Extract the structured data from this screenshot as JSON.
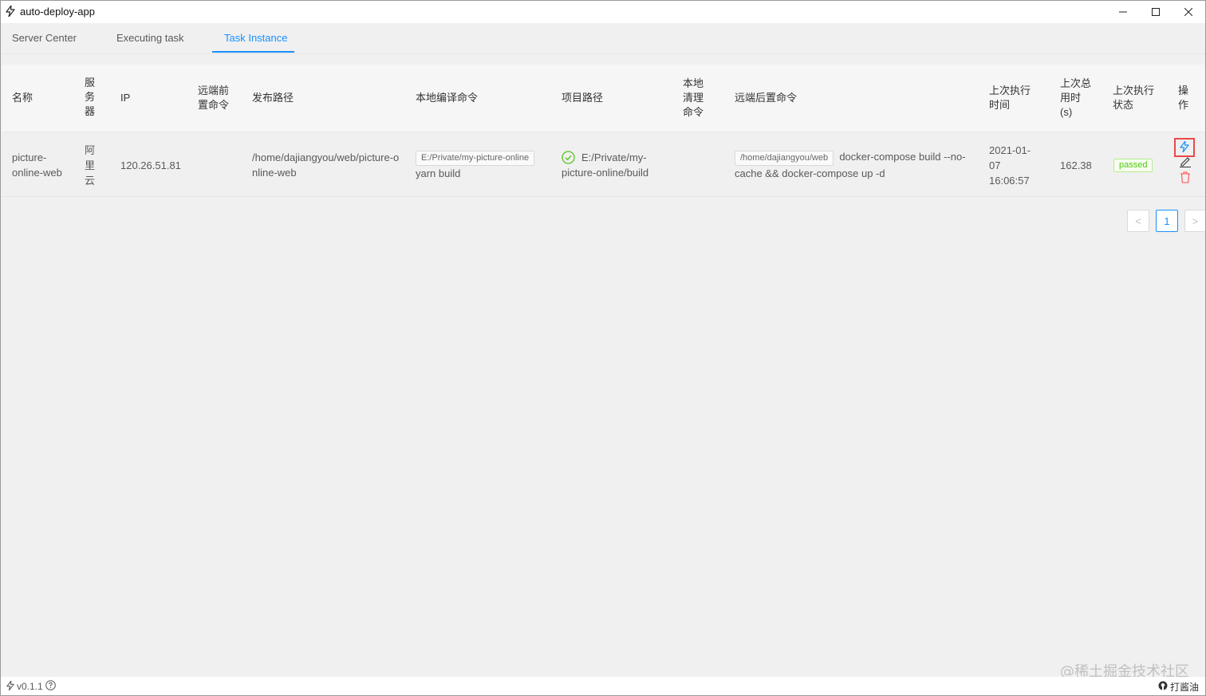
{
  "window": {
    "title": "auto-deploy-app",
    "controls": [
      "minimize-icon",
      "maximize-icon",
      "close-icon"
    ]
  },
  "tabs": [
    {
      "label": "Server Center",
      "active": false
    },
    {
      "label": "Executing task",
      "active": false
    },
    {
      "label": "Task Instance",
      "active": true
    }
  ],
  "table": {
    "headers": {
      "name": "名称",
      "server": "服务器",
      "ip": "IP",
      "remote_pre_cmd": "远端前置命令",
      "deploy_path": "发布路径",
      "local_build_cmd": "本地编译命令",
      "project_path": "项目路径",
      "local_cleanup": "本地清理命令",
      "remote_post_cmd": "远端后置命令",
      "last_exec_time": "上次执行时间",
      "last_duration": "上次总用时(s)",
      "last_status": "上次执行状态",
      "actions": "操作"
    },
    "rows": [
      {
        "name": "picture-online-web",
        "server": "阿里云",
        "ip": "120.26.51.81",
        "remote_pre_cmd": "",
        "deploy_path": "/home/dajiangyou/web/picture-online-web",
        "local_build_tag": "E:/Private/my-picture-online",
        "local_build_cmd": "yarn build",
        "project_path": "E:/Private/my-picture-online/build",
        "local_cleanup": "",
        "remote_post_tag": "/home/dajiangyou/web",
        "remote_post_cmd": "docker-compose build --no-cache && docker-compose up -d",
        "last_exec_time": "2021-01-07 16:06:57",
        "last_duration": "162.38",
        "last_status": "passed"
      }
    ]
  },
  "pagination": {
    "prev": "<",
    "current": "1",
    "next": ">"
  },
  "footer": {
    "version": "v0.1.1",
    "watermark": "@稀土掘金技术社区",
    "github_label": "打酱油"
  },
  "colors": {
    "accent": "#1890ff",
    "success": "#52c41a",
    "danger": "#ff4d4f",
    "highlight": "#e84a4a"
  }
}
